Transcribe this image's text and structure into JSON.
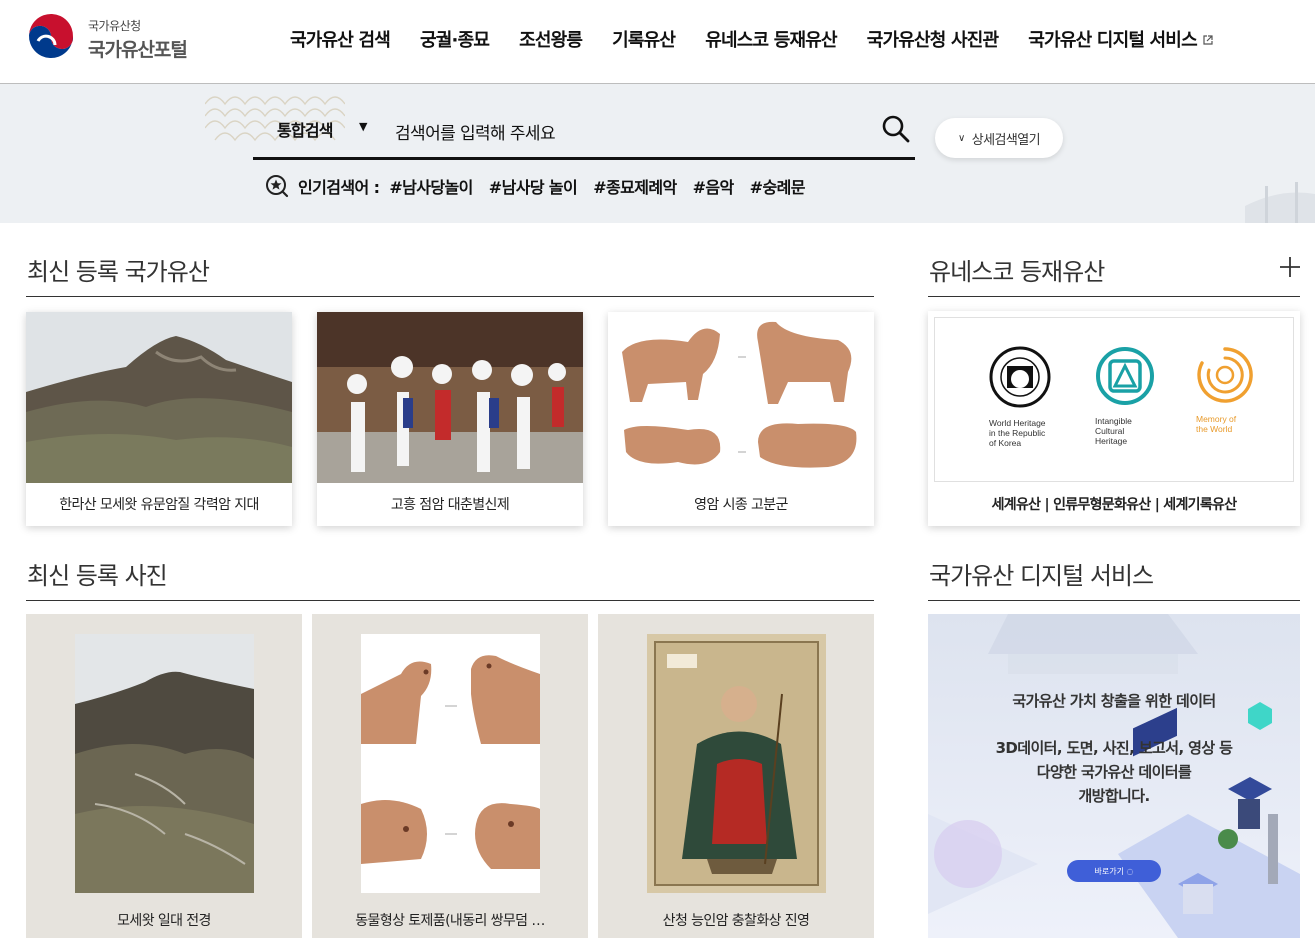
{
  "logo": {
    "sub": "국가유산청",
    "main": "국가유산포털"
  },
  "nav": [
    {
      "label": "국가유산 검색"
    },
    {
      "label": "궁궐·종묘"
    },
    {
      "label": "조선왕릉"
    },
    {
      "label": "기록유산"
    },
    {
      "label": "유네스코 등재유산"
    },
    {
      "label": "국가유산청 사진관"
    },
    {
      "label": "국가유산 디지털 서비스"
    }
  ],
  "search": {
    "scope": "통합검색",
    "placeholder": "검색어를 입력해 주세요",
    "detail_button": "상세검색열기",
    "popular_label": "인기검색어 :",
    "popular_tags": [
      "#남사당놀이",
      "#남사당 놀이",
      "#종묘제례악",
      "#음악",
      "#숭례문"
    ]
  },
  "latest_heritage": {
    "title": "최신 등록 국가유산",
    "items": [
      {
        "caption": "한라산 모세왓 유문암질 각력암 지대"
      },
      {
        "caption": "고흥 점암 대춘별신제"
      },
      {
        "caption": "영암 시종 고분군"
      }
    ]
  },
  "unesco": {
    "title": "유네스코 등재유산",
    "logos": [
      {
        "label": "World Heritage\nin the Republic\nof Korea"
      },
      {
        "label": "Intangible\nCultural\nHeritage"
      },
      {
        "label": "Memory of\nthe World"
      }
    ],
    "caption": "세계유산 | 인류무형문화유산 | 세계기록유산"
  },
  "latest_photos": {
    "title": "최신 등록 사진",
    "items": [
      {
        "caption": "모세왓 일대 전경"
      },
      {
        "caption": "동물형상 토제품(내동리 쌍무덤 …"
      },
      {
        "caption": "산청 능인암 충찰화상 진영"
      }
    ]
  },
  "digital": {
    "title": "국가유산 디지털 서비스",
    "banner_title": "국가유산 가치 창출을 위한 데이터",
    "banner_desc": [
      "3D데이터, 도면, 사진, 보고서, 영상 등",
      "다양한 국가유산 데이터를",
      "개방합니다."
    ],
    "go_button": "바로가기"
  },
  "colors": {
    "accent_red": "#c8102e",
    "accent_blue": "#003a8c",
    "unesco_teal": "#1aa1a6",
    "unesco_orange": "#f0a030"
  }
}
